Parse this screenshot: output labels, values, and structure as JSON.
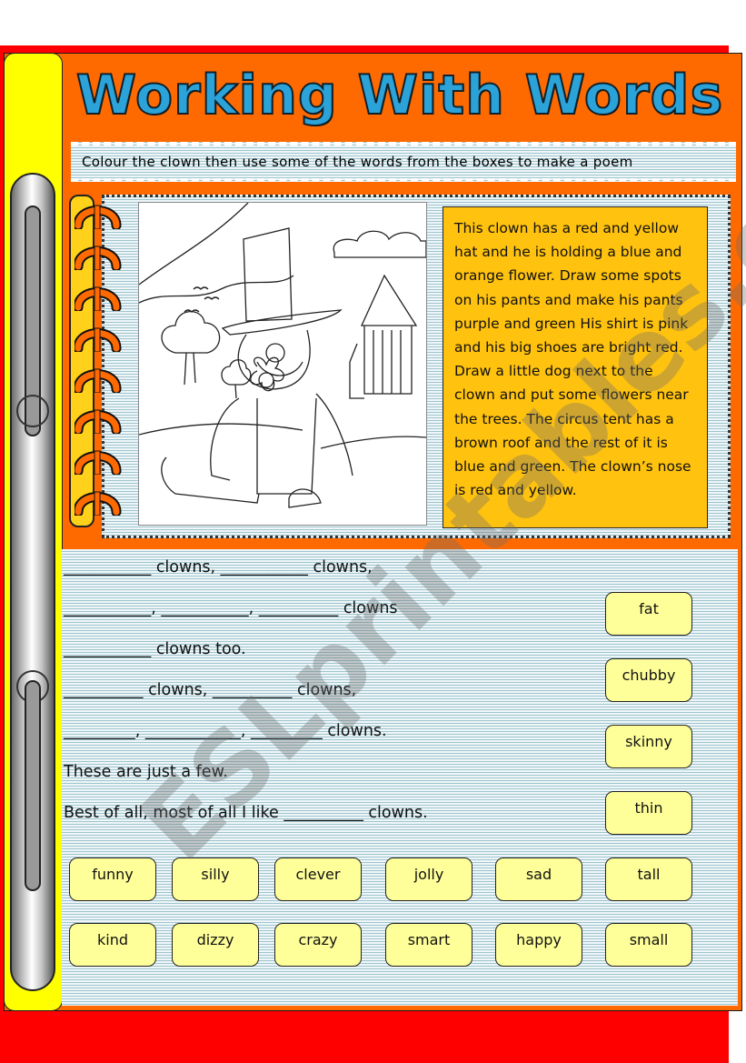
{
  "worksheet": {
    "title": "Working With Words",
    "instruction": "Colour the clown then use some of the words from the boxes to make a poem",
    "description": "This clown has a red and yellow hat and he is holding a blue and orange flower. Draw some spots on his pants and make his pants purple and green His shirt is pink and his big shoes are bright red. Draw a little dog next to the clown and put some flowers near the trees. The circus tent has a brown roof and the rest of it is blue and green. The clown’s nose is red and yellow.",
    "image_alt": "Clown colouring picture: clown with top hat holding a flower, trees, hills, birds and a circus tent",
    "watermark": "ESLprintables.com"
  },
  "poem": {
    "lines": [
      "___________ clowns, ___________ clowns,",
      "___________, ___________, __________ clowns",
      "___________ clowns too.",
      "__________ clowns, __________ clowns,",
      "_________, ____________, _________ clowns.",
      "These are just a few.",
      "Best of all, most of all I like __________ clowns."
    ]
  },
  "word_boxes": {
    "side": [
      "fat",
      "chubby",
      "skinny",
      "thin"
    ],
    "row1": [
      "funny",
      "silly",
      "clever",
      "jolly",
      "sad",
      "tall"
    ],
    "row2": [
      "kind",
      "dizzy",
      "crazy",
      "smart",
      "happy",
      "small"
    ]
  },
  "colors": {
    "frame_orange": "#ff6a00",
    "background_red": "#ff0000",
    "strip_yellow": "#ffff00",
    "title_blue": "#2ba3d8",
    "description_box": "#ffc20e",
    "word_box": "#ffff99"
  }
}
